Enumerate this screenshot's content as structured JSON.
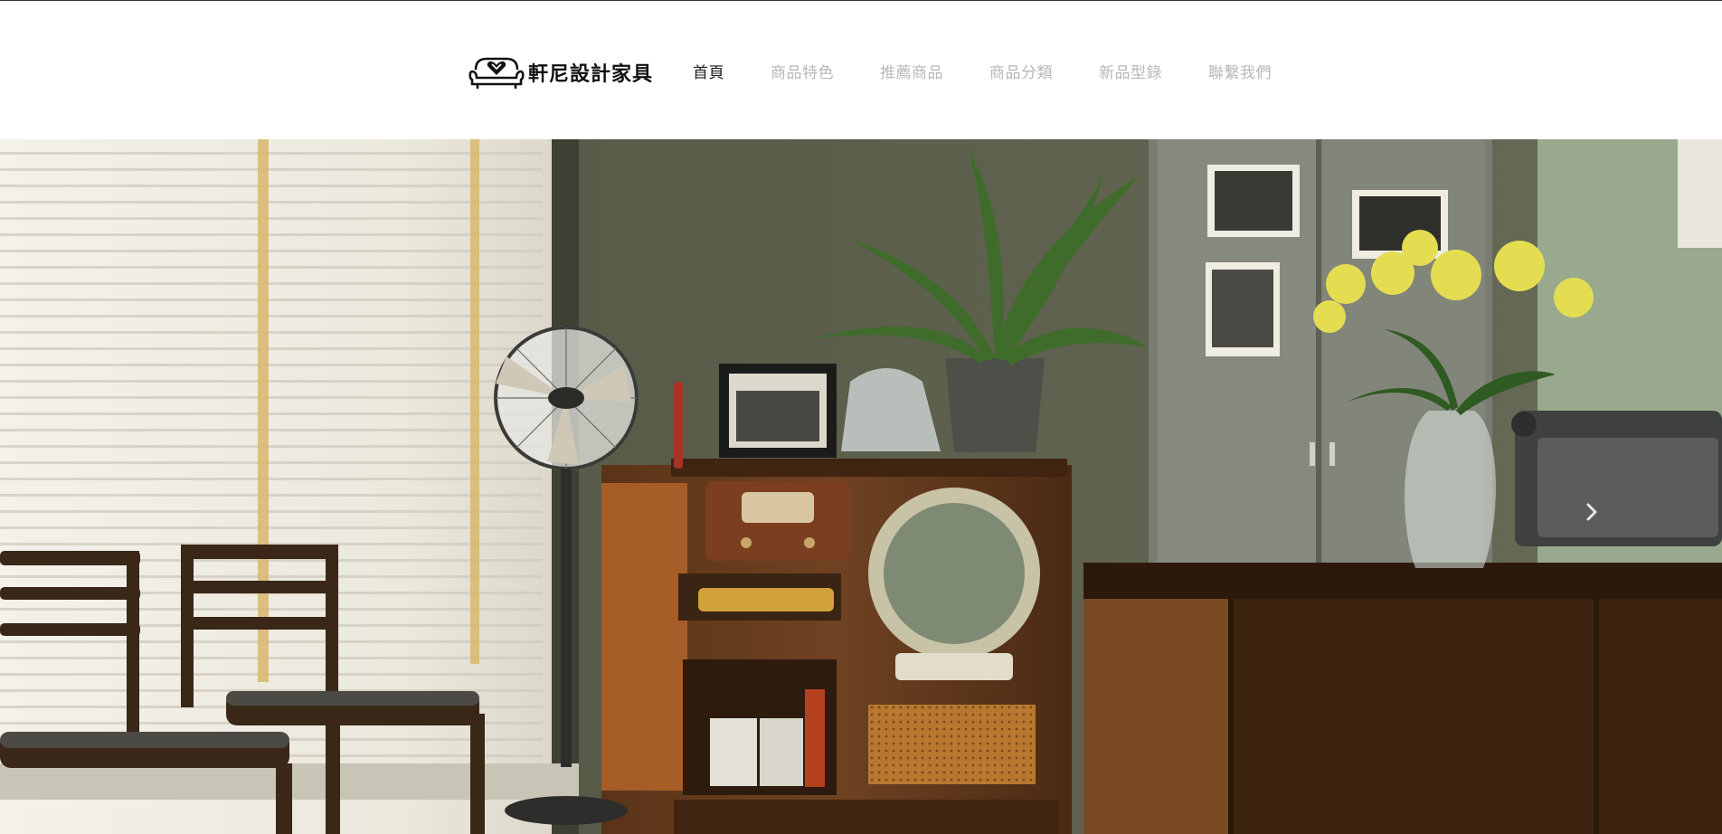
{
  "brand": {
    "name": "軒尼設計家具",
    "logo_icon": "sofa-heart-logo-icon"
  },
  "nav": {
    "items": [
      {
        "label": "首頁",
        "active": true
      },
      {
        "label": "商品特色",
        "active": false
      },
      {
        "label": "推薦商品",
        "active": false
      },
      {
        "label": "商品分類",
        "active": false
      },
      {
        "label": "新品型錄",
        "active": false
      },
      {
        "label": "聯繫我們",
        "active": false
      }
    ]
  },
  "hero": {
    "image_alt": "復古客廳：百葉窗、木椅、立扇、復古電視收音機櫃、盆栽、黃玫瑰花瓶與木桌",
    "next_icon": "chevron-right-icon"
  },
  "colors": {
    "nav_active": "#1f1f1f",
    "nav_inactive": "#b8b8b8",
    "brand_text": "#111111"
  }
}
